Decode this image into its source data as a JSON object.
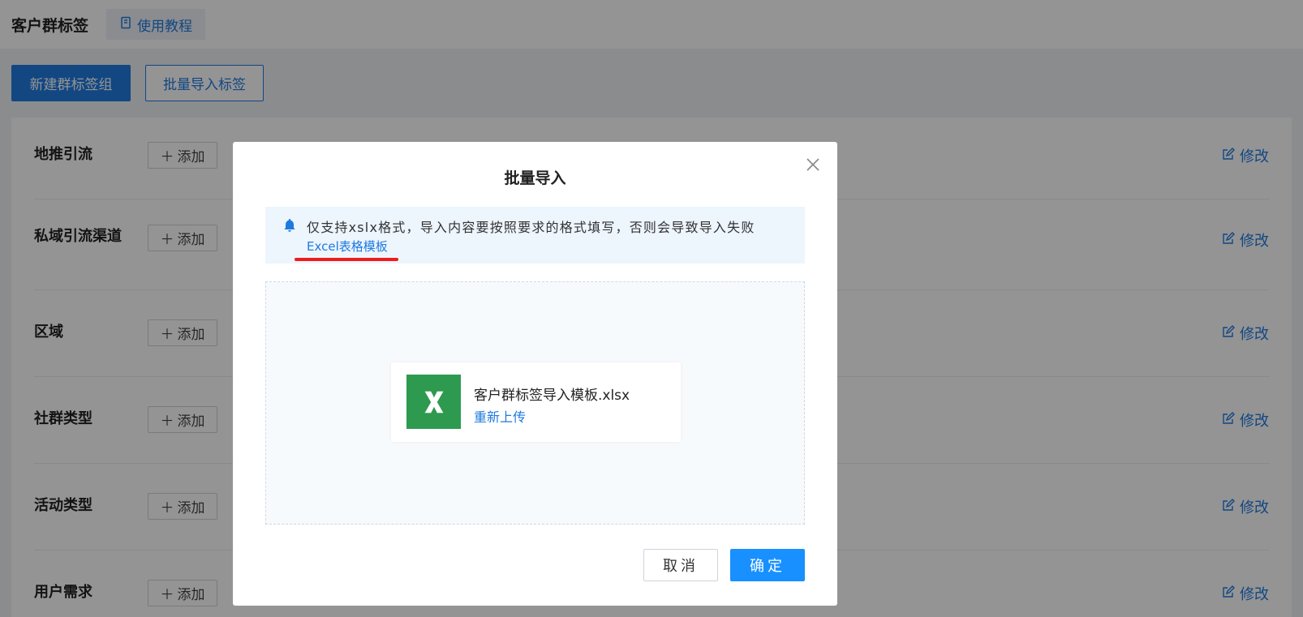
{
  "header": {
    "title": "客户群标签",
    "tutorial_label": "使用教程"
  },
  "actions": {
    "new_group_label": "新建群标签组",
    "batch_import_label": "批量导入标签"
  },
  "tag_groups": [
    {
      "name": "地推引流",
      "add_label": "添加",
      "edit_label": "修改"
    },
    {
      "name": "私域引流渠道",
      "add_label": "添加",
      "edit_label": "修改"
    },
    {
      "name": "区域",
      "add_label": "添加",
      "edit_label": "修改"
    },
    {
      "name": "社群类型",
      "add_label": "添加",
      "edit_label": "修改"
    },
    {
      "name": "活动类型",
      "add_label": "添加",
      "edit_label": "修改"
    },
    {
      "name": "用户需求",
      "add_label": "添加",
      "edit_label": "修改"
    }
  ],
  "modal": {
    "title": "批量导入",
    "notice_text": "仅支持xslx格式，导入内容要按照要求的格式填写，否则会导致导入失败",
    "template_link": "Excel表格模板",
    "file_name": "客户群标签导入模板.xlsx",
    "reupload_label": "重新上传",
    "cancel_label": "取消",
    "confirm_label": "确定"
  },
  "colors": {
    "primary": "#1f7ae0",
    "confirm": "#1890ff",
    "excel_green": "#2e9a4f",
    "annotation_red": "#ee1c1c"
  }
}
